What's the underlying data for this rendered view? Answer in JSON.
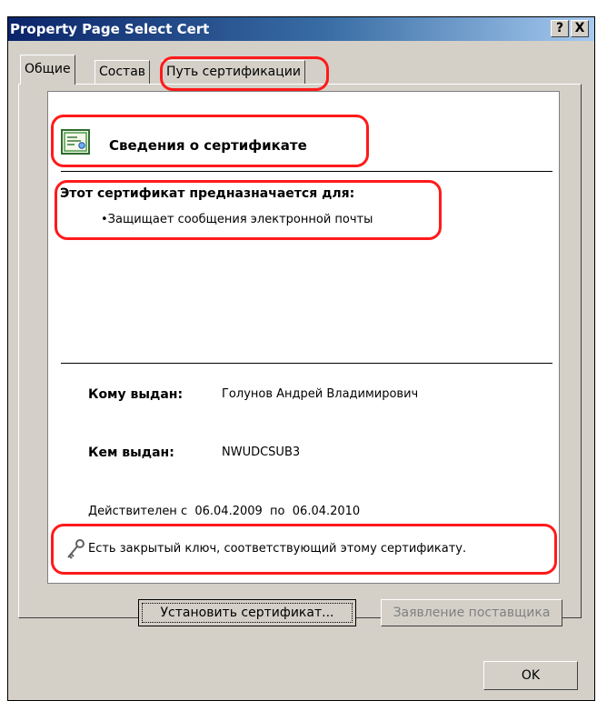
{
  "window": {
    "title": "Property Page Select Cert",
    "help_label": "?",
    "close_label": "X"
  },
  "tabs": [
    {
      "label": "Общие"
    },
    {
      "label": "Состав"
    },
    {
      "label": "Путь сертификации"
    }
  ],
  "cert": {
    "header": "Сведения о сертификате",
    "purpose_title": "Этот сертификат предназначается для:",
    "purpose_item": "•Защищает сообщения электронной почты",
    "issued_to_label": "Кому выдан:",
    "issued_to_value": "Голунов Андрей Владимирович",
    "issued_by_label": "Кем выдан:",
    "issued_by_value": "NWUDCSUB3",
    "validity": "Действителен с  06.04.2009  по  06.04.2010",
    "private_key_note": "Есть закрытый ключ, соответствующий этому сертификату."
  },
  "buttons": {
    "install": "Установить сертификат...",
    "issuer_statement": "Заявление поставщика",
    "ok": "OK"
  },
  "colors": {
    "annotation": "#ff1a1a",
    "title_bar": "#0a246a"
  }
}
